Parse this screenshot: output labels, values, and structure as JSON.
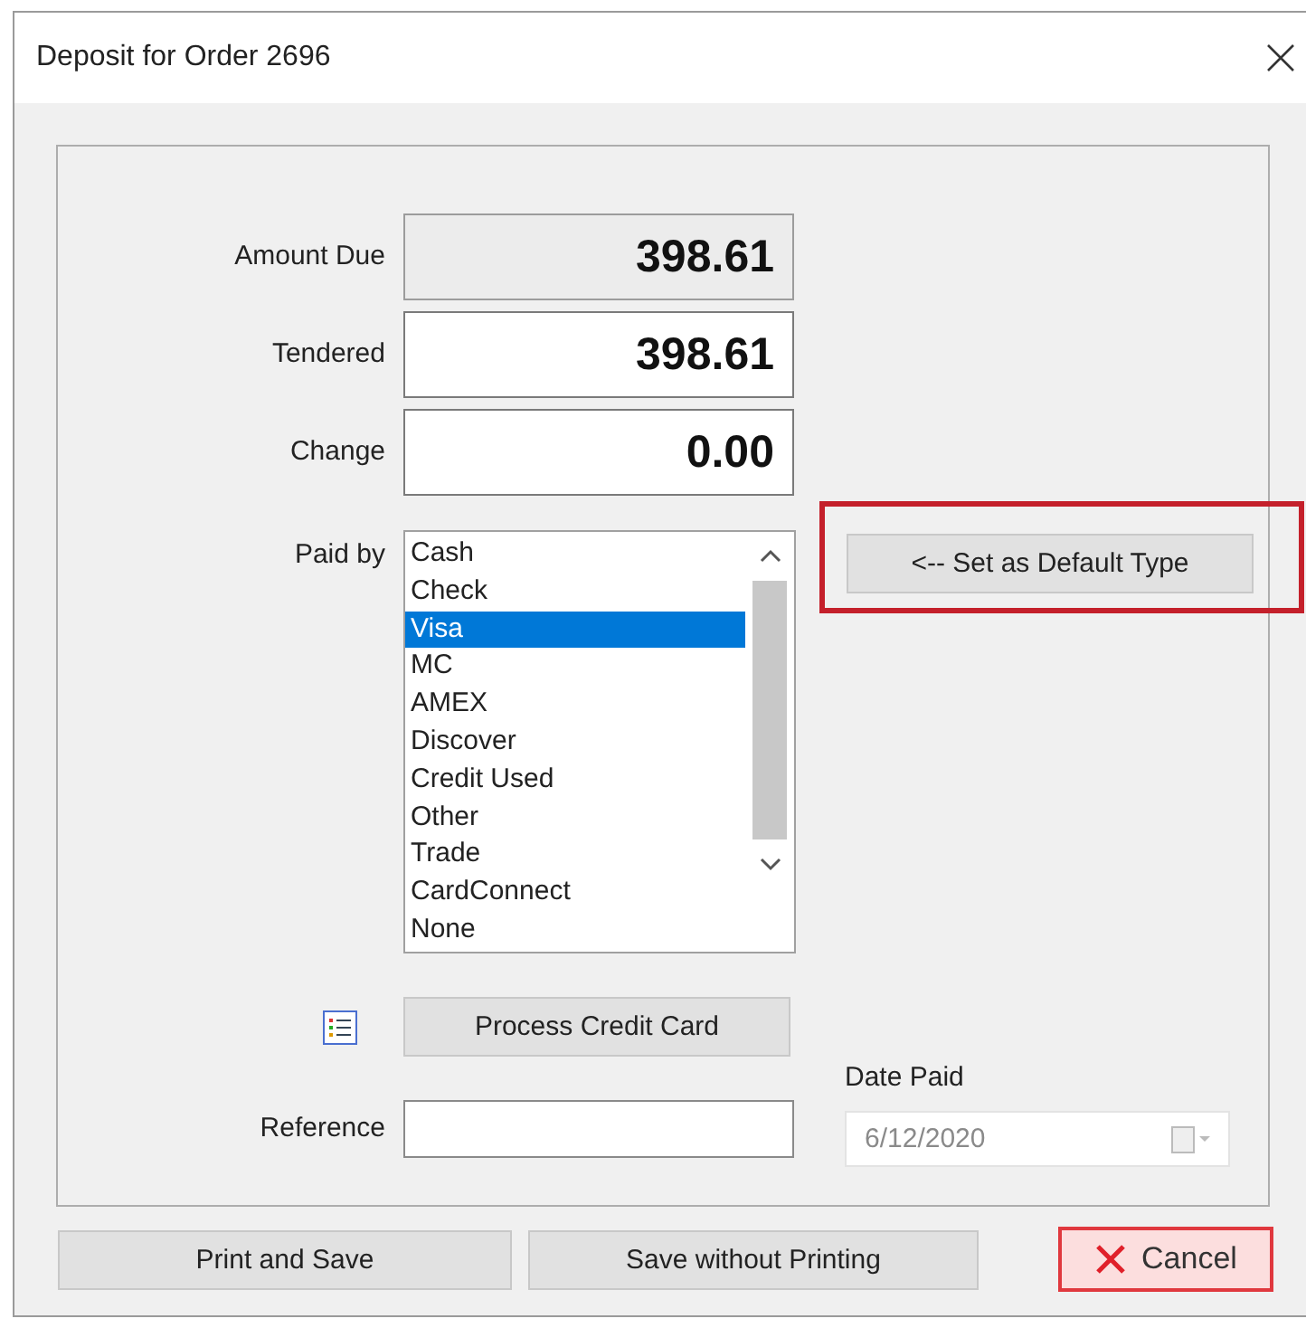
{
  "window": {
    "title": "Deposit for Order 2696"
  },
  "amounts": [
    {
      "label": "Amount Due",
      "value": "398.61",
      "readonly": true
    },
    {
      "label": "Tendered",
      "value": "398.61",
      "readonly": false
    },
    {
      "label": "Change",
      "value": "0.00",
      "readonly": false
    }
  ],
  "paid_by": {
    "label": "Paid by",
    "items": [
      {
        "label": "Cash",
        "selected": false
      },
      {
        "label": "Check",
        "selected": false
      },
      {
        "label": "Visa",
        "selected": true
      },
      {
        "label": "MC",
        "selected": false
      },
      {
        "label": "AMEX",
        "selected": false
      },
      {
        "label": "Discover",
        "selected": false
      },
      {
        "label": "Credit Used",
        "selected": false
      },
      {
        "label": "Other",
        "selected": false
      },
      {
        "label": "Trade",
        "selected": false
      },
      {
        "label": "CardConnect",
        "selected": false
      },
      {
        "label": "None",
        "selected": false
      }
    ]
  },
  "set_default_button": {
    "label": "<-- Set as Default Type",
    "highlighted": true
  },
  "process_button": "Process Credit Card",
  "reference": {
    "label": "Reference"
  },
  "date_paid": {
    "label": "Date Paid",
    "value": "6/12/2020",
    "disabled": true
  },
  "buttons": [
    {
      "label": "Print and Save",
      "kind": "plain"
    },
    {
      "label": "Save without Printing",
      "kind": "plain"
    },
    {
      "label": "Cancel",
      "kind": "cancel"
    }
  ]
}
